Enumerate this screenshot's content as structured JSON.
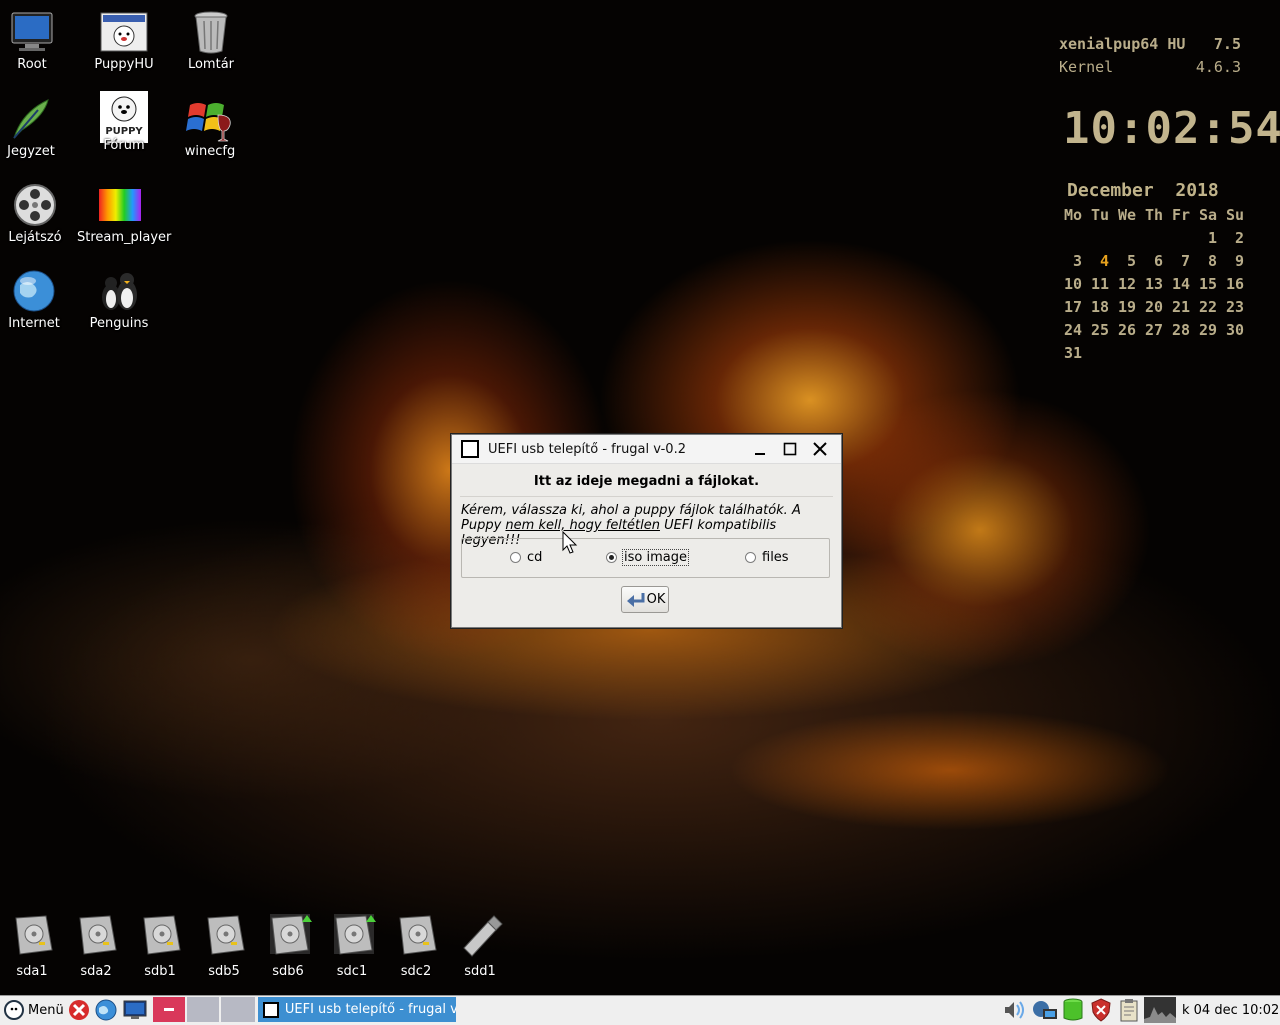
{
  "desktop": {
    "icons": [
      {
        "label": "Root",
        "icon": "computer-icon"
      },
      {
        "label": "PuppyHU",
        "icon": "puppyhu-icon"
      },
      {
        "label": "Lomtár",
        "icon": "trash-icon"
      },
      {
        "label": "Jegyzet",
        "icon": "quill-icon"
      },
      {
        "label": "Fórum",
        "icon": "puppy-linux-icon"
      },
      {
        "label": "winecfg",
        "icon": "wine-icon"
      },
      {
        "label": "Lejátszó",
        "icon": "film-reel-icon"
      },
      {
        "label": "Stream_player",
        "icon": "rainbow-icon"
      },
      {
        "label": "Internet",
        "icon": "globe-icon"
      },
      {
        "label": "Penguins",
        "icon": "penguins-icon"
      }
    ],
    "drives": [
      "sda1",
      "sda2",
      "sdb1",
      "sdb5",
      "sdb6",
      "sdc1",
      "sdc2",
      "sdd1"
    ]
  },
  "conky": {
    "distro": "xenialpup64 HU",
    "version": "7.5",
    "kernel_label": "Kernel",
    "kernel": "4.6.3",
    "time": "10:02:54",
    "month": "December  2018",
    "weekdays": [
      "Mo",
      "Tu",
      "We",
      "Th",
      "Fr",
      "Sa",
      "Su"
    ],
    "weeks": [
      [
        "",
        "",
        "",
        "",
        "",
        "1",
        "2"
      ],
      [
        "3",
        "4",
        "5",
        "6",
        "7",
        "8",
        "9"
      ],
      [
        "10",
        "11",
        "12",
        "13",
        "14",
        "15",
        "16"
      ],
      [
        "17",
        "18",
        "19",
        "20",
        "21",
        "22",
        "23"
      ],
      [
        "24",
        "25",
        "26",
        "27",
        "28",
        "29",
        "30"
      ],
      [
        "31",
        "",
        "",
        "",
        "",
        "",
        ""
      ]
    ],
    "today": "4",
    "today_color": "#e8a21e"
  },
  "dialog": {
    "title": "UEFI usb telepítő - frugal v-0.2",
    "heading": "Itt az ideje megadni a fájlokat.",
    "msg_part1": "Kérem, válassza ki, ahol a puppy fájlok találhatók. A Puppy ",
    "msg_underline": "nem kell, hogy feltétlen",
    "msg_part2": " UEFI kompatibilis legyen!!!",
    "options": [
      {
        "label": "cd",
        "selected": false
      },
      {
        "label": "iso image",
        "selected": true
      },
      {
        "label": "files",
        "selected": false
      }
    ],
    "ok_label": "OK"
  },
  "taskbar": {
    "menu_label": "Menü",
    "task_label": "UEFI usb telepítő - frugal v",
    "clock": "k 04 dec 10:02"
  }
}
